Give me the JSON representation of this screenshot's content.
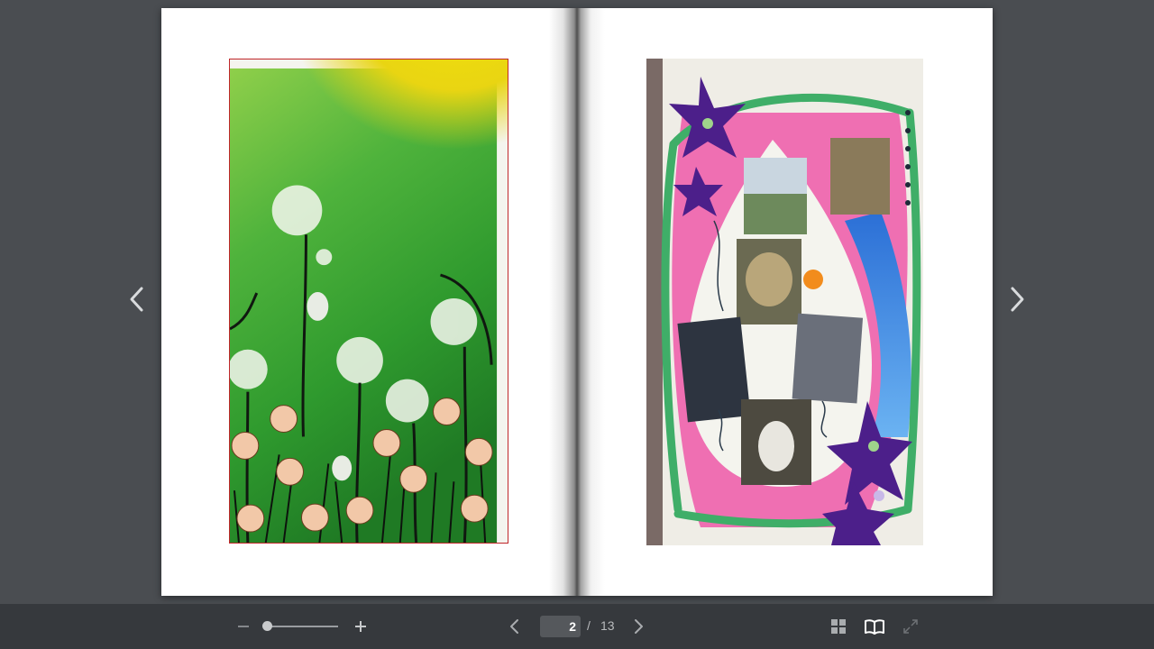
{
  "viewer": {
    "current_page": "2",
    "separator": "/",
    "total_pages": "13"
  },
  "icons": {
    "prev_page": "chevron-left-icon",
    "next_page": "chevron-right-icon",
    "zoom_out": "minus-icon",
    "zoom_in": "plus-icon",
    "thumbnails": "grid-icon",
    "book_view": "open-book-icon",
    "fullscreen": "expand-icon"
  },
  "colors": {
    "background": "#4a4d51",
    "toolbar": "#36393d",
    "icon": "#c8cacc",
    "icon_dim": "#85888c",
    "active_icon": "#ffffff"
  },
  "zoom": {
    "level": 0
  }
}
